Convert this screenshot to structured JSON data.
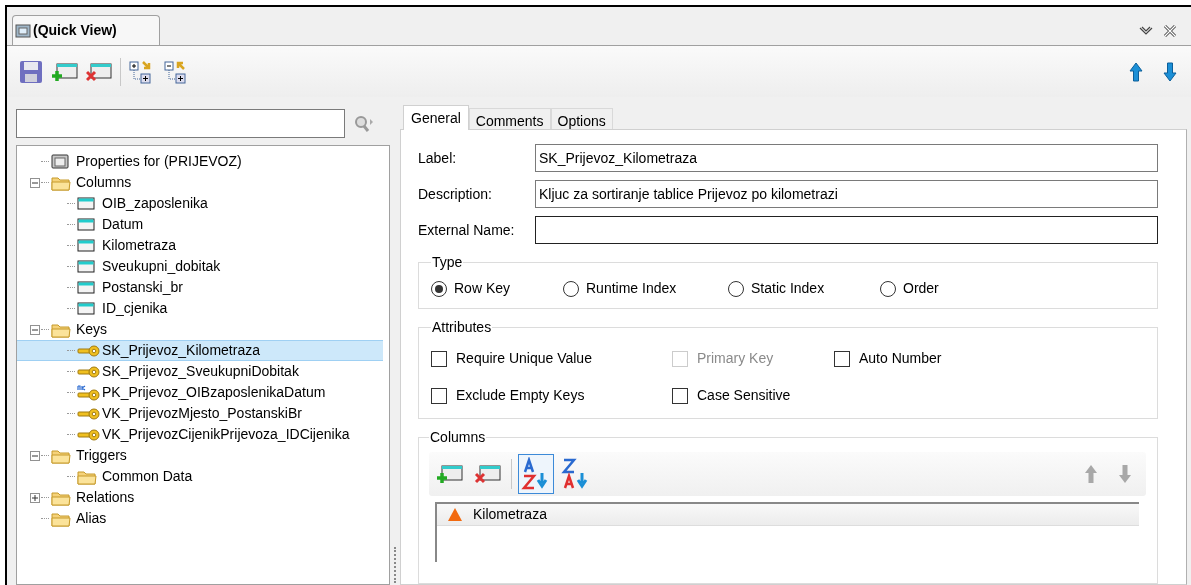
{
  "window": {
    "tab_title": "(Quick View)"
  },
  "tree": [
    {
      "label": "Properties for (PRIJEVOZ)",
      "kind": "properties",
      "selected": false
    },
    {
      "label": "Columns",
      "kind": "folder",
      "expanded": true,
      "selected": false,
      "children": [
        {
          "label": "OIB_zaposlenika",
          "kind": "column",
          "selected": false
        },
        {
          "label": "Datum",
          "kind": "column",
          "selected": false
        },
        {
          "label": "Kilometraza",
          "kind": "column",
          "selected": false
        },
        {
          "label": "Sveukupni_dobitak",
          "kind": "column",
          "selected": false
        },
        {
          "label": "Postanski_br",
          "kind": "column",
          "selected": false
        },
        {
          "label": "ID_cjenika",
          "kind": "column",
          "selected": false
        }
      ]
    },
    {
      "label": "Keys",
      "kind": "folder",
      "expanded": true,
      "selected": false,
      "children": [
        {
          "label": "SK_Prijevoz_Kilometraza",
          "kind": "key",
          "selected": true
        },
        {
          "label": "SK_Prijevoz_SveukupniDobitak",
          "kind": "key",
          "selected": false
        },
        {
          "label": "PK_Prijevoz_OIBzaposlenikaDatum",
          "kind": "primary-key",
          "selected": false
        },
        {
          "label": "VK_PrijevozMjesto_PostanskiBr",
          "kind": "key",
          "selected": false
        },
        {
          "label": "VK_PrijevozCijenikPrijevoza_IDCijenika",
          "kind": "key",
          "selected": false
        }
      ]
    },
    {
      "label": "Triggers",
      "kind": "folder",
      "expanded": true,
      "selected": false,
      "children": [
        {
          "label": "Common Data",
          "kind": "folder",
          "selected": false
        }
      ]
    },
    {
      "label": "Relations",
      "kind": "folder",
      "expanded": false,
      "selected": false
    },
    {
      "label": "Alias",
      "kind": "folder",
      "selected": false
    }
  ],
  "tabs": [
    {
      "label": "General",
      "selected": true
    },
    {
      "label": "Comments",
      "selected": false
    },
    {
      "label": "Options",
      "selected": false
    }
  ],
  "fields": [
    {
      "label": "Label:",
      "value": "SK_Prijevoz_Kilometraza"
    },
    {
      "label": "Description:",
      "value": "Kljuc za sortiranje tablice Prijevoz po kilometrazi"
    },
    {
      "label": "External Name:"
    }
  ],
  "type_group": {
    "title": "Type",
    "options": [
      {
        "label": "Row Key",
        "selected": true
      },
      {
        "label": "Runtime Index",
        "selected": false
      },
      {
        "label": "Static Index",
        "selected": false
      },
      {
        "label": "Order",
        "selected": false
      }
    ]
  },
  "attributes_group": {
    "title": "Attributes",
    "options": [
      {
        "label": "Require Unique Value",
        "checked": false,
        "disabled": false
      },
      {
        "label": "Primary Key",
        "checked": false,
        "disabled": true
      },
      {
        "label": "Auto Number",
        "checked": false,
        "disabled": false
      },
      {
        "label": "Exclude Empty Keys",
        "checked": false,
        "disabled": false
      },
      {
        "label": "Case Sensitive",
        "checked": false,
        "disabled": false
      }
    ]
  },
  "columns_group": {
    "title": "Columns",
    "tools": [
      {
        "kind": "add"
      },
      {
        "kind": "delete"
      },
      {
        "kind": "sort-ascending",
        "selected": true
      },
      {
        "kind": "sort-descending",
        "selected": false
      }
    ],
    "move_tools": [
      {
        "kind": "up",
        "disabled": true
      },
      {
        "kind": "down",
        "disabled": true
      }
    ],
    "list_columns": [
      {
        "label": "Kilometraza",
        "sorted_ascending": true
      }
    ]
  }
}
